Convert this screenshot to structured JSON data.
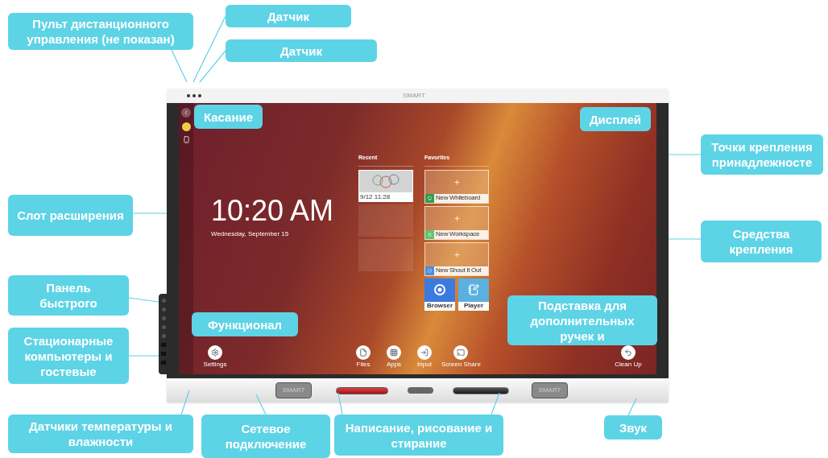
{
  "device": {
    "logo": "SMART",
    "eraser_labels": [
      "SMART",
      "SMART"
    ]
  },
  "screen": {
    "time": "10:20 AM",
    "date": "Wednesday, September 15",
    "recent": {
      "title": "Recent",
      "items": [
        {
          "caption": "9/12 11:28"
        }
      ]
    },
    "favorites": {
      "title": "Favorites",
      "tiles": [
        {
          "label": "New Whiteboard",
          "color": "#2e9e4f"
        },
        {
          "label": "New Workspace",
          "color": "#62c46e"
        },
        {
          "label": "New Shout It Out",
          "color": "#4a8fe0"
        }
      ],
      "apps": [
        {
          "label": "Browser"
        },
        {
          "label": "Player"
        }
      ]
    },
    "dock": [
      {
        "label": "Settings"
      },
      {
        "label": "Files"
      },
      {
        "label": "Apps"
      },
      {
        "label": "Input"
      },
      {
        "label": "Screen Share"
      },
      {
        "label": "Clean Up"
      }
    ]
  },
  "callouts": [
    {
      "text": "Пульт дистанционного управления (не показан)"
    },
    {
      "text": "Датчик"
    },
    {
      "text": "Датчик"
    },
    {
      "text": "Касание"
    },
    {
      "text": "Дисплей"
    },
    {
      "text": "Точки крепления принадлежносте"
    },
    {
      "text": "Слот расширения"
    },
    {
      "text": "Средства крепления"
    },
    {
      "text": "Панель быстрого"
    },
    {
      "text": "Функционал"
    },
    {
      "text": "Подставка для дополнительных ручек и"
    },
    {
      "text": "Стационарные компьютеры и гостевые"
    },
    {
      "text": "Датчики температуры и влажности"
    },
    {
      "text": "Сетевое подключение"
    },
    {
      "text": "Написание, рисование и стирание"
    },
    {
      "text": "Звук"
    }
  ]
}
